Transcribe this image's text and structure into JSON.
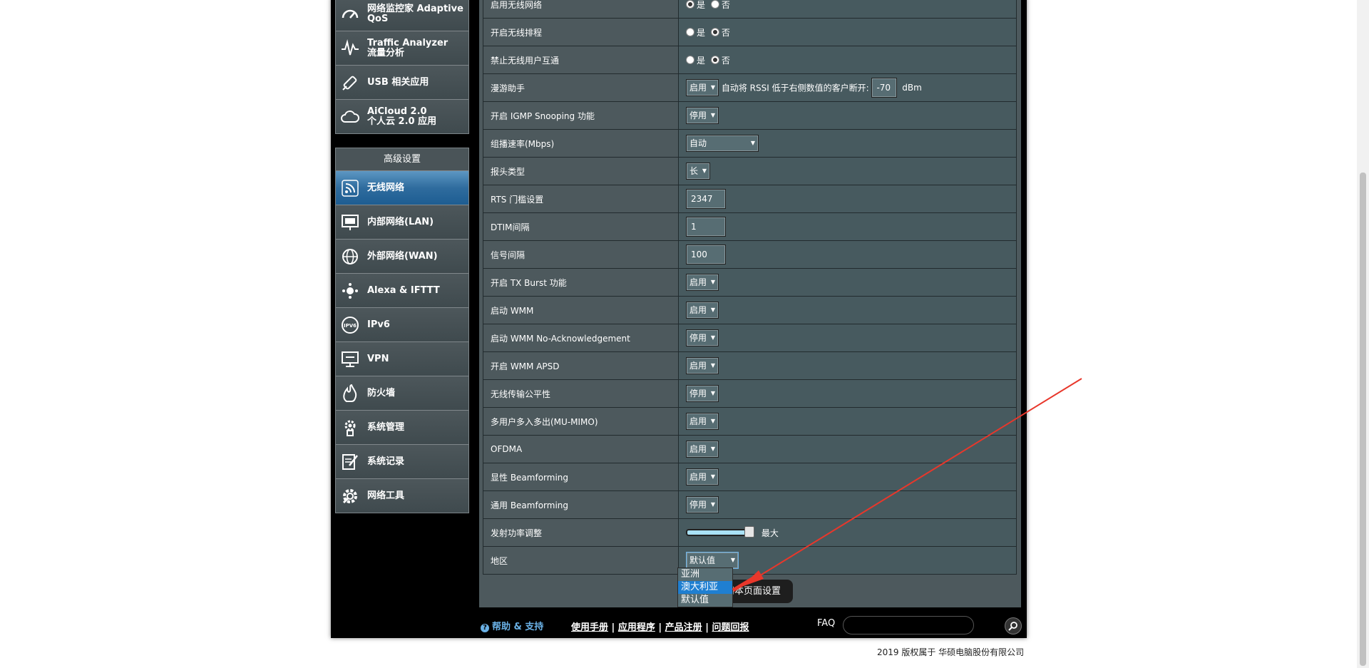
{
  "sidebar_top": [
    {
      "label_line1": "网络监控家 Adaptive",
      "label_line2": "QoS",
      "icon": "gauge-icon"
    },
    {
      "label_line1": "Traffic Analyzer",
      "label_line2": "流量分析",
      "icon": "waveform-icon"
    },
    {
      "label_line1": "USB 相关应用",
      "label_line2": "",
      "icon": "usb-icon"
    },
    {
      "label_line1": "AiCloud 2.0",
      "label_line2": "个人云 2.0 应用",
      "icon": "cloud-icon"
    }
  ],
  "advanced": {
    "header": "高级设置",
    "items": [
      {
        "label": "无线网络",
        "icon": "wifi-icon",
        "active": true
      },
      {
        "label": "内部网络(LAN)",
        "icon": "lan-icon",
        "active": false
      },
      {
        "label": "外部网络(WAN)",
        "icon": "globe-icon",
        "active": false
      },
      {
        "label": "Alexa & IFTTT",
        "icon": "alexa-icon",
        "active": false
      },
      {
        "label": "IPv6",
        "icon": "ipv6-icon",
        "active": false
      },
      {
        "label": "VPN",
        "icon": "vpn-icon",
        "active": false
      },
      {
        "label": "防火墙",
        "icon": "firewall-icon",
        "active": false
      },
      {
        "label": "系统管理",
        "icon": "gear-icon",
        "active": false
      },
      {
        "label": "系统记录",
        "icon": "log-icon",
        "active": false
      },
      {
        "label": "网络工具",
        "icon": "tools-icon",
        "active": false
      }
    ]
  },
  "radio_labels": {
    "yes": "是",
    "no": "否"
  },
  "rows": {
    "r0": {
      "label": "启用无线网络"
    },
    "r1": {
      "label": "开启无线排程"
    },
    "r2": {
      "label": "禁止无线用户互通"
    },
    "r3": {
      "label": "漫游助手",
      "value": "启用",
      "text": "自动将 RSSI 低于右侧数值的客户断开:",
      "rssi": "-70",
      "unit": "dBm"
    },
    "r4": {
      "label": "开启 IGMP Snooping 功能",
      "value": "停用"
    },
    "r5": {
      "label": "组播速率(Mbps)",
      "value": "自动"
    },
    "r6": {
      "label": "报头类型",
      "value": "长"
    },
    "r7": {
      "label": "RTS 门槛设置",
      "value": "2347"
    },
    "r8": {
      "label": "DTIM间隔",
      "value": "1"
    },
    "r9": {
      "label": "信号间隔",
      "value": "100"
    },
    "r10": {
      "label": "开启 TX Burst 功能",
      "value": "启用"
    },
    "r11": {
      "label": "启动 WMM",
      "value": "启用"
    },
    "r12": {
      "label": "启动 WMM No-Acknowledgement",
      "value": "停用"
    },
    "r13": {
      "label": "开启 WMM APSD",
      "value": "启用"
    },
    "r14": {
      "label": "无线传输公平性",
      "value": "停用"
    },
    "r15": {
      "label": "多用户多入多出(MU-MIMO)",
      "value": "启用"
    },
    "r16": {
      "label": "OFDMA",
      "value": "启用"
    },
    "r17": {
      "label": "显性 Beamforming",
      "value": "启用"
    },
    "r18": {
      "label": "通用 Beamforming",
      "value": "停用"
    },
    "r19": {
      "label": "发射功率调整",
      "level_text": "最大",
      "level_fraction": 1.0
    },
    "r20": {
      "label": "地区",
      "value": "默认值"
    }
  },
  "region_options": [
    "亚洲",
    "澳大利亚",
    "默认值"
  ],
  "region_highlighted": "澳大利亚",
  "apply_label": "用本页面设置",
  "footer": {
    "help": "帮助 & 支持",
    "links": [
      "使用手册",
      "应用程序",
      "产品注册",
      "问题回报"
    ],
    "faq": "FAQ"
  },
  "copyright": "2019 版权属于 华硕电脑股份有限公司",
  "colors": {
    "accent_active": "#2f6c9e",
    "annotation_arrow": "#e8372b",
    "help_text": "#6ab1e6"
  }
}
